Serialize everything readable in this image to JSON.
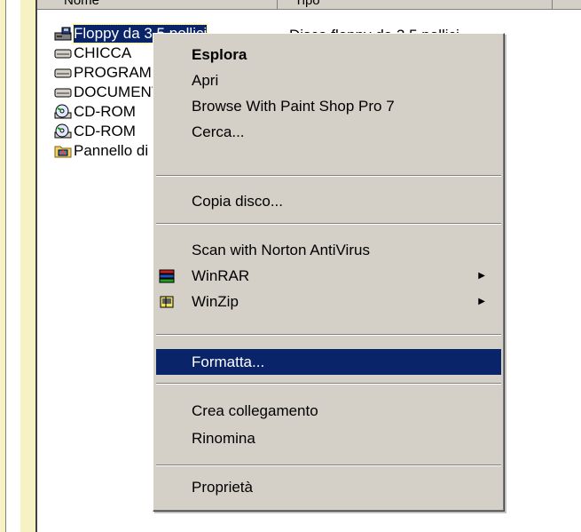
{
  "columns": {
    "name": "Nome",
    "type": "Tipo"
  },
  "files": [
    {
      "label": "Floppy da 3,5 pollici",
      "icon": "floppy-drive-icon",
      "selected": true
    },
    {
      "label": "CHICCA",
      "icon": "hard-drive-icon"
    },
    {
      "label": "PROGRAMMI",
      "icon": "hard-drive-icon"
    },
    {
      "label": "DOCUMENTI",
      "icon": "hard-drive-icon"
    },
    {
      "label": "CD-ROM",
      "icon": "cdrom-drive-icon"
    },
    {
      "label": "CD-ROM",
      "icon": "cdrom-drive-icon"
    },
    {
      "label": "Pannello di controllo",
      "icon": "control-panel-icon"
    }
  ],
  "selected_type": "Disco floppy da 3,5 pollici",
  "context_menu": {
    "items": [
      {
        "label": "Esplora",
        "bold": true,
        "mnemonic": "s"
      },
      {
        "label": "Apri",
        "mnemonic": "A"
      },
      {
        "label": "Browse With Paint Shop Pro 7",
        "mnemonic": "B"
      },
      {
        "label": "Cerca...",
        "mnemonic": "r"
      },
      {
        "label": "Copia disco...",
        "mnemonic": "C"
      },
      {
        "label": "Scan with Norton AntiVirus",
        "mnemonic": "V"
      },
      {
        "label": "WinRAR",
        "submenu": true,
        "icon": "winrar-icon"
      },
      {
        "label": "WinZip",
        "submenu": true,
        "icon": "winzip-icon",
        "mnemonic": "Z"
      },
      {
        "label": "Formatta...",
        "highlighted": true,
        "mnemonic": "F"
      },
      {
        "label": "Crea collegamento",
        "mnemonic": "m"
      },
      {
        "label": "Rinomina",
        "mnemonic": "o"
      },
      {
        "label": "Proprietà",
        "mnemonic": "P"
      }
    ]
  },
  "colors": {
    "highlight": "#0a246a",
    "menu_bg": "#d4d0c8",
    "desktop": "#f7f2c4"
  }
}
